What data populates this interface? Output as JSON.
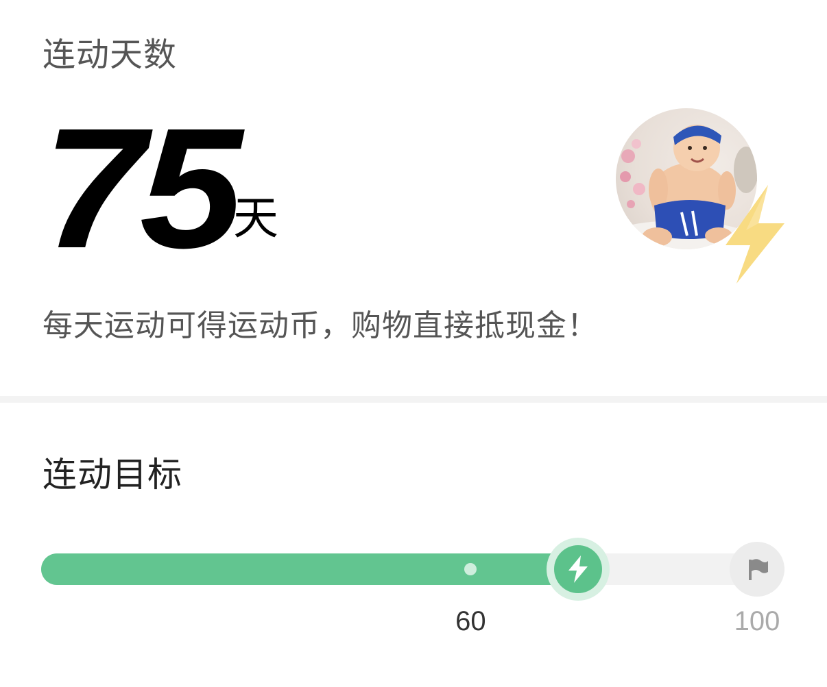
{
  "streak": {
    "title": "连动天数",
    "days": "75",
    "unit": "天",
    "description": "每天运动可得运动币，购物直接抵现金！"
  },
  "avatar": {
    "icon": "baby-photo-avatar",
    "badge_icon": "lightning-bolt-icon",
    "badge_color": "#f7d877"
  },
  "goal": {
    "title": "连动目标",
    "current_days": 75,
    "milestone_days": 60,
    "target_days": 100,
    "milestone_label": "60",
    "target_label": "100",
    "fill_color": "#62c590",
    "track_color": "#f2f2f2",
    "thumb_icon": "lightning-bolt-icon",
    "end_icon": "flag-icon"
  }
}
